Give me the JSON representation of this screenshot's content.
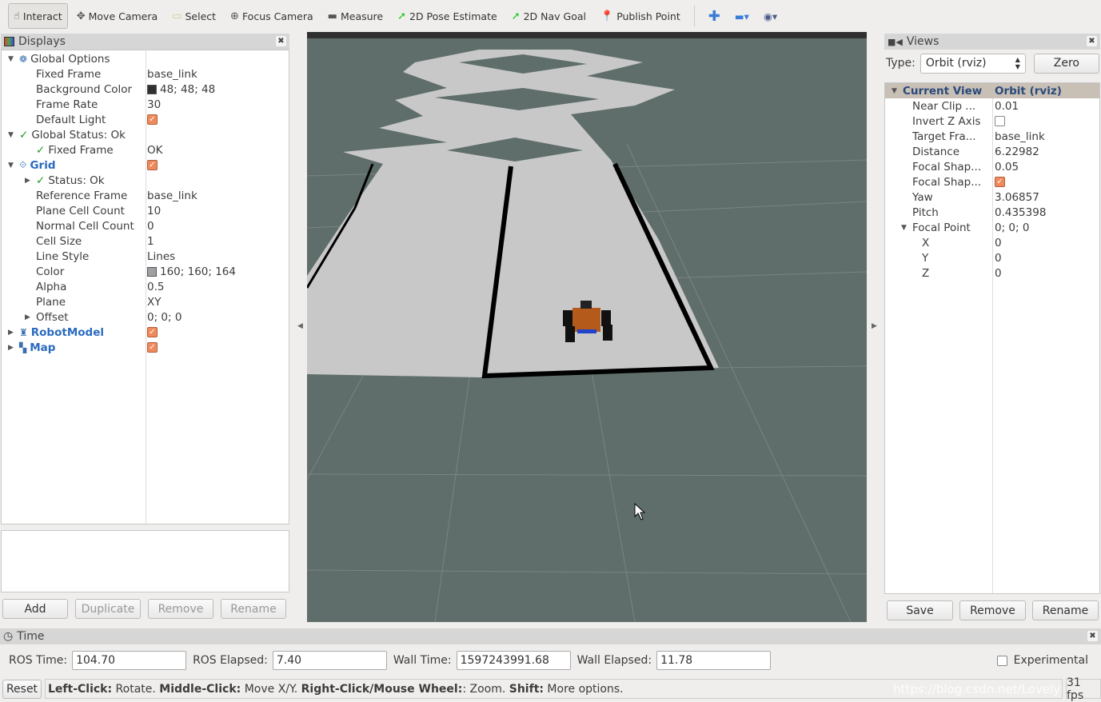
{
  "toolbar": {
    "tools": [
      {
        "label": "Interact",
        "icon": "hand-icon",
        "active": true
      },
      {
        "label": "Move Camera",
        "icon": "move-camera-icon"
      },
      {
        "label": "Select",
        "icon": "select-icon"
      },
      {
        "label": "Focus Camera",
        "icon": "focus-camera-icon"
      },
      {
        "label": "Measure",
        "icon": "ruler-icon"
      },
      {
        "label": "2D Pose Estimate",
        "icon": "green-arrow-icon"
      },
      {
        "label": "2D Nav Goal",
        "icon": "green-arrow-icon"
      },
      {
        "label": "Publish Point",
        "icon": "map-pin-icon"
      }
    ]
  },
  "displays": {
    "title": "Displays",
    "rows": [
      {
        "indent": 0,
        "arrow": "▼",
        "icon": "gear-icon",
        "key": "Global Options",
        "value": ""
      },
      {
        "indent": 1,
        "key": "Fixed Frame",
        "value": "base_link"
      },
      {
        "indent": 1,
        "key": "Background Color",
        "value": "48; 48; 48",
        "swatch": "#303030"
      },
      {
        "indent": 1,
        "key": "Frame Rate",
        "value": "30"
      },
      {
        "indent": 1,
        "key": "Default Light",
        "check": true
      },
      {
        "indent": 0,
        "arrow": "▼",
        "ok": true,
        "key": "Global Status: Ok",
        "value": ""
      },
      {
        "indent": 1,
        "ok": true,
        "key": "Fixed Frame",
        "value": "OK"
      },
      {
        "indent": 0,
        "arrow": "▼",
        "icon": "grid-icon",
        "key": "Grid",
        "blue": true,
        "check": true
      },
      {
        "indent": 1,
        "arrow": "▶",
        "ok": true,
        "key": "Status: Ok",
        "value": ""
      },
      {
        "indent": 1,
        "key": "Reference Frame",
        "value": "base_link"
      },
      {
        "indent": 1,
        "key": "Plane Cell Count",
        "value": "10"
      },
      {
        "indent": 1,
        "key": "Normal Cell Count",
        "value": "0"
      },
      {
        "indent": 1,
        "key": "Cell Size",
        "value": "1"
      },
      {
        "indent": 1,
        "key": "Line Style",
        "value": "Lines"
      },
      {
        "indent": 1,
        "key": "Color",
        "value": "160; 160; 164",
        "swatch": "#a0a0a4"
      },
      {
        "indent": 1,
        "key": "Alpha",
        "value": "0.5"
      },
      {
        "indent": 1,
        "key": "Plane",
        "value": "XY"
      },
      {
        "indent": 1,
        "arrow": "▶",
        "key": "Offset",
        "value": "0; 0; 0"
      },
      {
        "indent": 0,
        "arrow": "▶",
        "icon": "robot-icon",
        "key": "RobotModel",
        "blue": true,
        "check": true
      },
      {
        "indent": 0,
        "arrow": "▶",
        "icon": "map-icon",
        "key": "Map",
        "blue": true,
        "check": true
      }
    ],
    "buttons": [
      {
        "label": "Add",
        "enabled": true
      },
      {
        "label": "Duplicate",
        "enabled": false
      },
      {
        "label": "Remove",
        "enabled": false
      },
      {
        "label": "Rename",
        "enabled": false
      }
    ]
  },
  "views": {
    "title": "Views",
    "type_label": "Type:",
    "type_value": "Orbit (rviz)",
    "zero_label": "Zero",
    "header": {
      "key": "Current View",
      "value": "Orbit (rviz)"
    },
    "rows": [
      {
        "indent": 1,
        "key": "Near Clip ...",
        "value": "0.01"
      },
      {
        "indent": 1,
        "key": "Invert Z Axis",
        "uncheck": true
      },
      {
        "indent": 1,
        "key": "Target Fra...",
        "value": "base_link"
      },
      {
        "indent": 1,
        "key": "Distance",
        "value": "6.22982"
      },
      {
        "indent": 1,
        "key": "Focal Shap...",
        "value": "0.05"
      },
      {
        "indent": 1,
        "key": "Focal Shap...",
        "check": true
      },
      {
        "indent": 1,
        "key": "Yaw",
        "value": "3.06857"
      },
      {
        "indent": 1,
        "key": "Pitch",
        "value": "0.435398"
      },
      {
        "indent": 1,
        "arrow": "▼",
        "key": "Focal Point",
        "value": "0; 0; 0"
      },
      {
        "indent": 2,
        "key": "X",
        "value": "0"
      },
      {
        "indent": 2,
        "key": "Y",
        "value": "0"
      },
      {
        "indent": 2,
        "key": "Z",
        "value": "0"
      }
    ],
    "buttons": [
      "Save",
      "Remove",
      "Rename"
    ]
  },
  "time": {
    "title": "Time",
    "ros_time_label": "ROS Time:",
    "ros_time": "104.70",
    "ros_elapsed_label": "ROS Elapsed:",
    "ros_elapsed": "7.40",
    "wall_time_label": "Wall Time:",
    "wall_time": "1597243991.68",
    "wall_elapsed_label": "Wall Elapsed:",
    "wall_elapsed": "11.78",
    "experimental_label": "Experimental"
  },
  "status": {
    "reset_label": "Reset",
    "b1": "Left-Click:",
    "t1": " Rotate. ",
    "b2": "Middle-Click:",
    "t2": " Move X/Y. ",
    "b3": "Right-Click/Mouse Wheel:",
    "t3": ": Zoom. ",
    "b4": "Shift:",
    "t4": " More options.",
    "fps": "31 fps",
    "watermark": "https://blog.csdn.net/Lovely"
  },
  "colors": {
    "viewport_bg": "#5f6e6b",
    "accent": "#2a6bbf",
    "check": "#f08a5d"
  }
}
